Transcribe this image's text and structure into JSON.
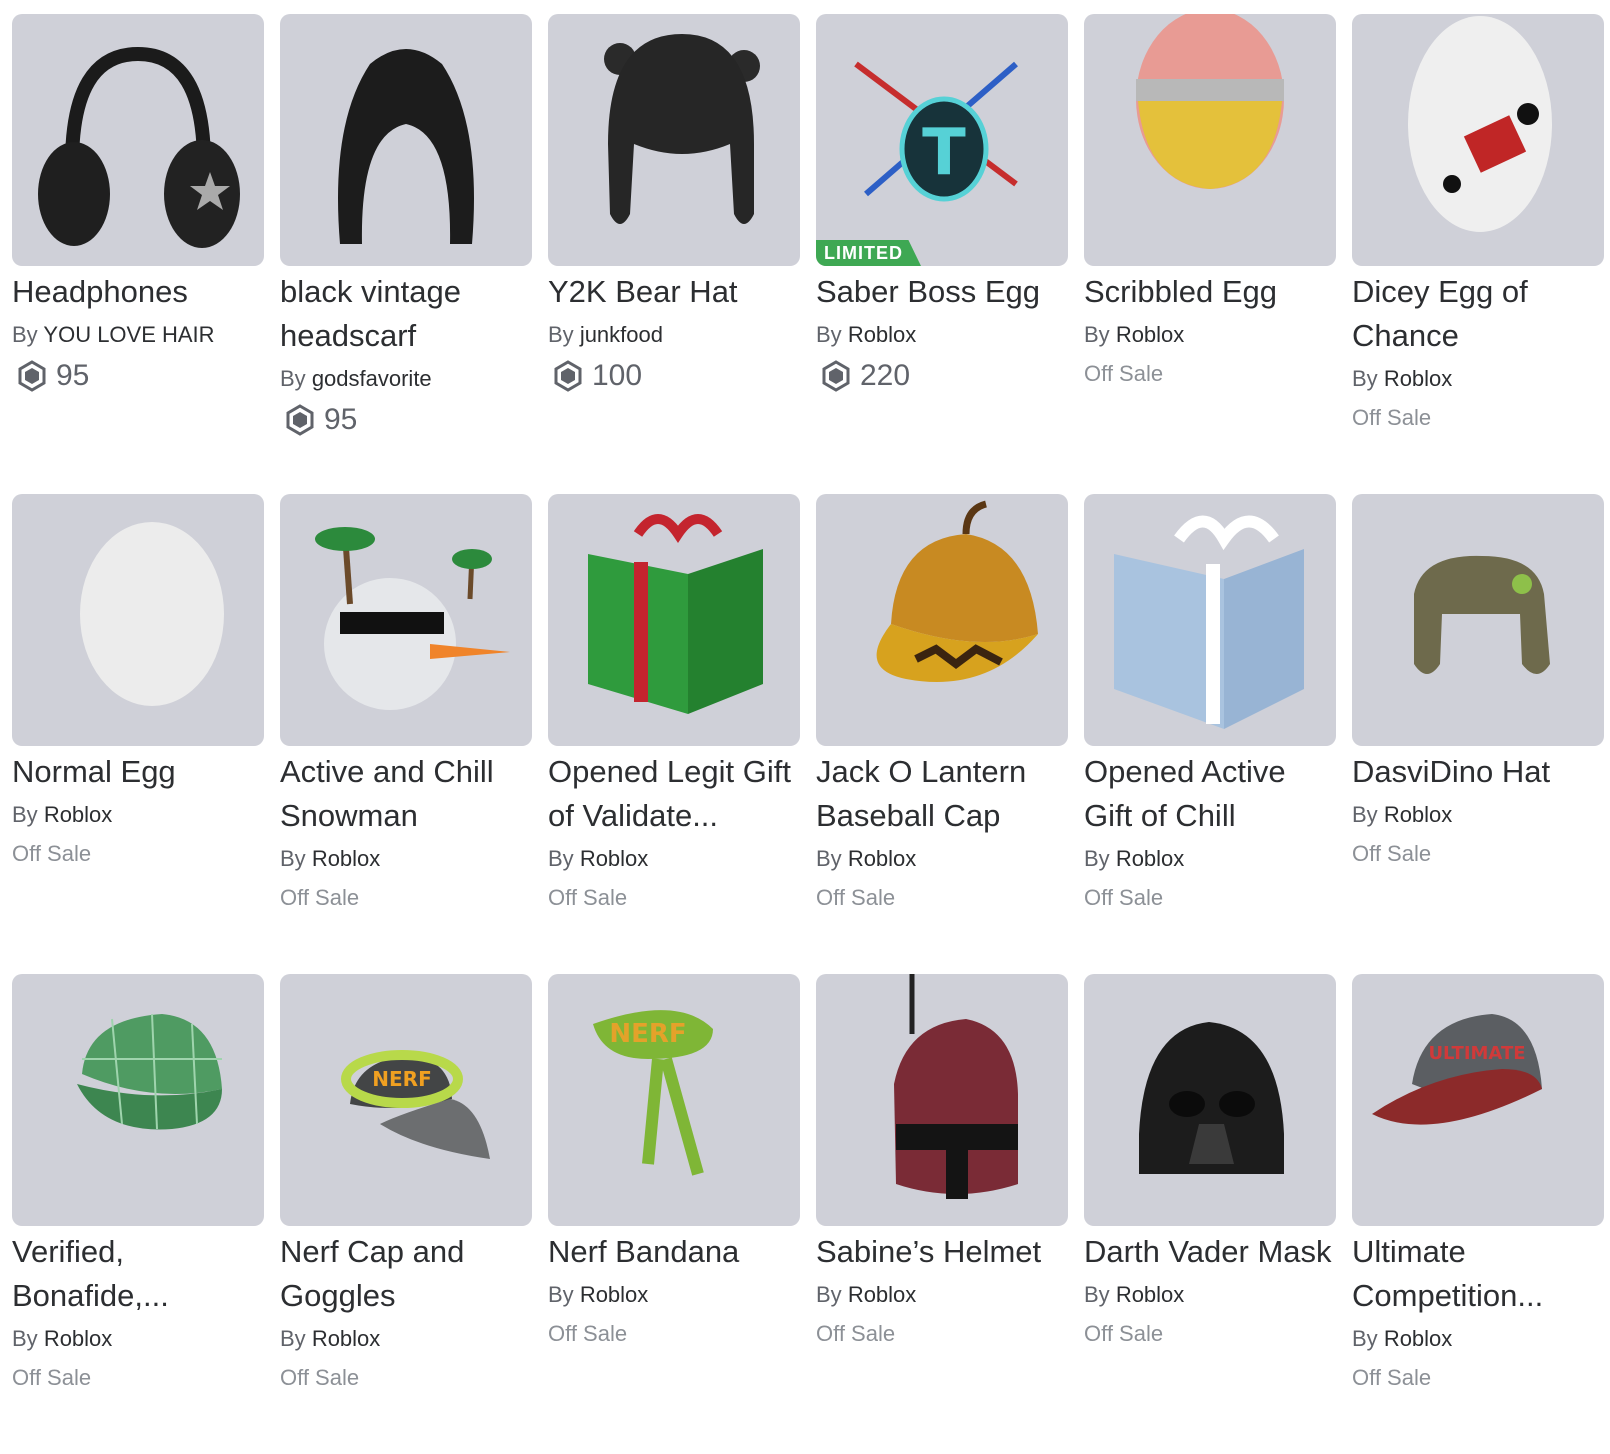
{
  "items": [
    {
      "name": "Headphones",
      "by_prefix": "By",
      "creator": "YOU LOVE HAIR",
      "price": "95",
      "offsale": null,
      "limited": null,
      "thumb_icon": "headphones-icon"
    },
    {
      "name": "black vintage headscarf",
      "by_prefix": "By",
      "creator": "godsfavorite",
      "price": "95",
      "offsale": null,
      "limited": null,
      "thumb_icon": "headscarf-icon"
    },
    {
      "name": "Y2K Bear Hat",
      "by_prefix": "By",
      "creator": "junkfood",
      "price": "100",
      "offsale": null,
      "limited": null,
      "thumb_icon": "bear-hat-icon"
    },
    {
      "name": "Saber Boss Egg",
      "by_prefix": "By",
      "creator": "Roblox",
      "price": "220",
      "offsale": null,
      "limited": "LIMITED",
      "thumb_icon": "saber-egg-icon"
    },
    {
      "name": "Scribbled Egg",
      "by_prefix": "By",
      "creator": "Roblox",
      "price": null,
      "offsale": "Off Sale",
      "limited": null,
      "thumb_icon": "scribbled-egg-icon"
    },
    {
      "name": "Dicey Egg of Chance",
      "by_prefix": "By",
      "creator": "Roblox",
      "price": null,
      "offsale": "Off Sale",
      "limited": null,
      "thumb_icon": "dice-egg-icon"
    },
    {
      "name": "Normal Egg",
      "by_prefix": "By",
      "creator": "Roblox",
      "price": null,
      "offsale": "Off Sale",
      "limited": null,
      "thumb_icon": "egg-icon"
    },
    {
      "name": "Active and Chill Snowman",
      "by_prefix": "By",
      "creator": "Roblox",
      "price": null,
      "offsale": "Off Sale",
      "limited": null,
      "thumb_icon": "snowman-icon"
    },
    {
      "name": "Opened Legit Gift of Validate...",
      "by_prefix": "By",
      "creator": "Roblox",
      "price": null,
      "offsale": "Off Sale",
      "limited": null,
      "thumb_icon": "green-gift-icon"
    },
    {
      "name": "Jack O Lantern Baseball Cap",
      "by_prefix": "By",
      "creator": "Roblox",
      "price": null,
      "offsale": "Off Sale",
      "limited": null,
      "thumb_icon": "pumpkin-cap-icon"
    },
    {
      "name": "Opened Active Gift of Chill",
      "by_prefix": "By",
      "creator": "Roblox",
      "price": null,
      "offsale": "Off Sale",
      "limited": null,
      "thumb_icon": "blue-gift-icon"
    },
    {
      "name": "DasviDino Hat",
      "by_prefix": "By",
      "creator": "Roblox",
      "price": null,
      "offsale": "Off Sale",
      "limited": null,
      "thumb_icon": "trapper-hat-icon"
    },
    {
      "name": "Verified, Bonafide,...",
      "by_prefix": "By",
      "creator": "Roblox",
      "price": null,
      "offsale": "Off Sale",
      "limited": null,
      "thumb_icon": "plaid-cap-icon"
    },
    {
      "name": "Nerf Cap and Goggles",
      "by_prefix": "By",
      "creator": "Roblox",
      "price": null,
      "offsale": "Off Sale",
      "limited": null,
      "thumb_icon": "nerf-cap-icon"
    },
    {
      "name": "Nerf Bandana",
      "by_prefix": "By",
      "creator": "Roblox",
      "price": null,
      "offsale": "Off Sale",
      "limited": null,
      "thumb_icon": "nerf-bandana-icon"
    },
    {
      "name": "Sabine’s Helmet",
      "by_prefix": "By",
      "creator": "Roblox",
      "price": null,
      "offsale": "Off Sale",
      "limited": null,
      "thumb_icon": "helmet-icon"
    },
    {
      "name": "Darth Vader Mask",
      "by_prefix": "By",
      "creator": "Roblox",
      "price": null,
      "offsale": "Off Sale",
      "limited": null,
      "thumb_icon": "vader-mask-icon"
    },
    {
      "name": "Ultimate Competition...",
      "by_prefix": "By",
      "creator": "Roblox",
      "price": null,
      "offsale": "Off Sale",
      "limited": null,
      "thumb_icon": "competition-cap-icon"
    }
  ],
  "colors": {
    "thumb_bg": "#cfd0d8",
    "limited_badge": "#3ea853",
    "text_primary": "#2c2e31",
    "text_secondary": "#60636a",
    "offsale": "#8c9096"
  }
}
